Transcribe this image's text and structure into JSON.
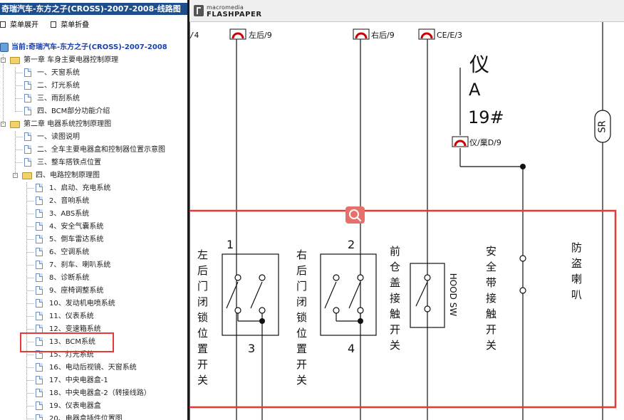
{
  "window": {
    "title": "奇瑞汽车-东方之子(CROSS)-2007-2008-线路图"
  },
  "menu": {
    "expand_label": "菜单展开",
    "collapse_label": "菜单折叠"
  },
  "tree": {
    "root": "当前:奇瑞汽车-东方之子(CROSS)-2007-2008",
    "items": [
      "第一章 车身主要电器控制原理",
      "一、天窗系统",
      "二、灯光系统",
      "三、雨刮系统",
      "四、BCM部分功能介绍",
      "第二章 电器系统控制原理图",
      "一、读图说明",
      "二、全车主要电器盒和控制器位置示意图",
      "三、整车搭铁点位置",
      "四、电路控制原理图",
      "1、启动、充电系统",
      "2、音响系统",
      "3、ABS系统",
      "4、安全气囊系统",
      "5、倒车雷达系统",
      "6、空调系统",
      "7、刹车、喇叭系统",
      "8、诊断系统",
      "9、座椅调整系统",
      "10、发动机电喷系统",
      "11、仪表系统",
      "12、变速箱系统",
      "13、BCM系统",
      "15、灯光系统",
      "16、电动后视镜、天窗系统",
      "17、中央电器盒-1",
      "18、中央电器盒-2（转接线路）",
      "19、仪表电器盒",
      "20、电器盒插件位置图"
    ]
  },
  "viewer": {
    "logo_top": "macromedia",
    "logo_bottom": "FLASHPAPER"
  },
  "diagram": {
    "top_left_label": "/4",
    "connectors": [
      "左后/9",
      "右后/9",
      "CE/E/3",
      "仪/棄D/9"
    ],
    "module_name": "仪",
    "module_letter": "A",
    "module_number": "19#",
    "sr_label": "SR",
    "switch1_number": "1",
    "switch1_pin": "3",
    "switch1_label": "左后门闭锁位置开关",
    "switch2_number": "2",
    "switch2_pin": "4",
    "switch2_label": "右后门闭锁位置开关",
    "hood_label": "前仓盖接触开关",
    "hood_sw": "HOOD SW",
    "belt_label": "安全带接触开关",
    "horn_label": "防盗喇叭"
  },
  "colors": {
    "highlight": "#e53935",
    "title_bg": "#1f4e8c",
    "connector_red": "#cc0000",
    "zoom_btn": "#e8706b"
  }
}
